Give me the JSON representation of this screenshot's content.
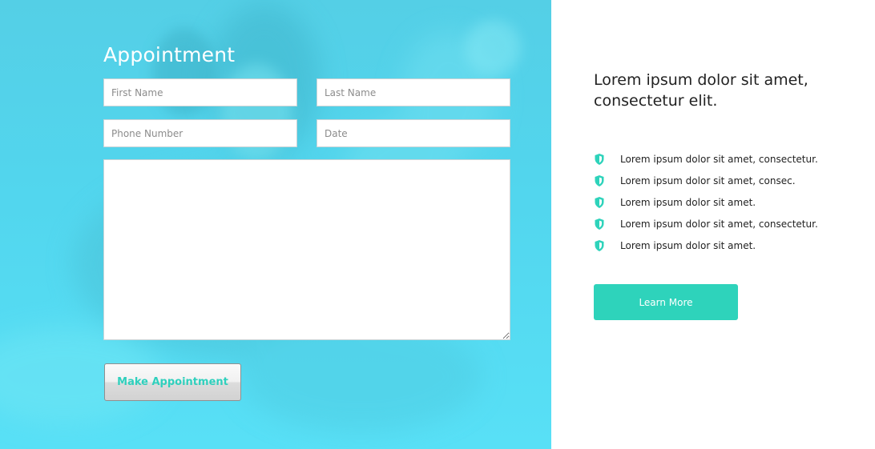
{
  "appointment": {
    "title": "Appointment",
    "first_name_placeholder": "First Name",
    "last_name_placeholder": "Last Name",
    "phone_placeholder": "Phone Number",
    "date_placeholder": "Date",
    "message_value": "",
    "submit_label": "Make Appointment"
  },
  "info": {
    "heading": "Lorem ipsum dolor sit amet, consectetur elit.",
    "features": [
      {
        "icon": "shield-icon",
        "text": "Lorem ipsum dolor sit amet, consectetur."
      },
      {
        "icon": "shield-icon",
        "text": "Lorem ipsum dolor sit amet, consec."
      },
      {
        "icon": "shield-icon",
        "text": "Lorem ipsum dolor sit amet."
      },
      {
        "icon": "shield-icon",
        "text": "Lorem ipsum dolor sit amet, consectetur."
      },
      {
        "icon": "shield-icon",
        "text": "Lorem ipsum dolor sit amet."
      }
    ],
    "learn_more_label": "Learn More"
  },
  "colors": {
    "panel_bg": "#54d4ec",
    "accent": "#2ed3bb",
    "text_dark": "#222222"
  }
}
